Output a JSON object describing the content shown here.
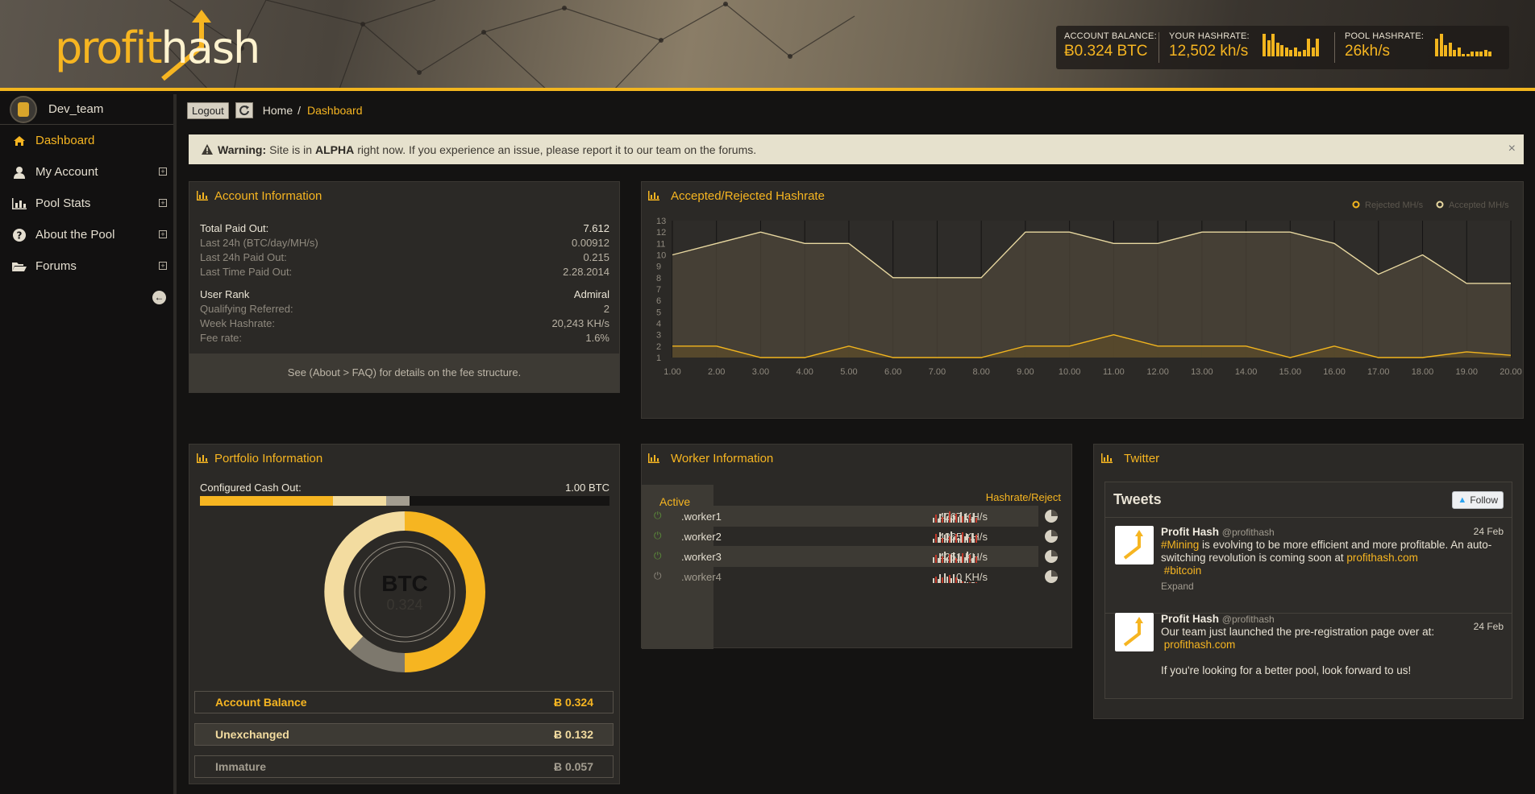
{
  "header": {
    "logo_profit": "profit",
    "logo_hash": "hash",
    "stats": [
      {
        "label": "ACCOUNT BALANCE:",
        "value": "Ƀ0.324 BTC"
      },
      {
        "label": "YOUR HASHRATE:",
        "value": "12,502 kh/s"
      },
      {
        "label": "POOL HASHRATE:",
        "value": "26kh/s"
      }
    ],
    "your_hashrate_spark": [
      10,
      7,
      10,
      6,
      5,
      4,
      3,
      4,
      2,
      3,
      8,
      4,
      8
    ],
    "pool_hashrate_spark": [
      8,
      10,
      5,
      6,
      3,
      4,
      1,
      1,
      2,
      2,
      2,
      3,
      2
    ],
    "accent_color": "#f2b51e"
  },
  "sidebar": {
    "user": "Dev_team",
    "items": [
      {
        "label": "Dashboard",
        "icon": "home-icon",
        "active": true
      },
      {
        "label": "My Account",
        "icon": "user-icon"
      },
      {
        "label": "Pool Stats",
        "icon": "bar-chart-icon"
      },
      {
        "label": "About the Pool",
        "icon": "question-circle-icon"
      },
      {
        "label": "Forums",
        "icon": "folder-open-icon"
      }
    ],
    "expand_symbol": "+",
    "collapse_symbol": "➜"
  },
  "toolbar": {
    "logout": "Logout",
    "breadcrumb_home": "Home",
    "breadcrumb_sep": "/",
    "breadcrumb_current": "Dashboard"
  },
  "warning": {
    "label": "Warning:",
    "text_before": "Site is in",
    "highlight": "ALPHA",
    "text_after": "right now. If you experience an issue, please report it to our team on the forums.",
    "close": "×"
  },
  "account": {
    "title": "Account Information",
    "rows": [
      {
        "k": "Total Paid Out:",
        "v": "7.612",
        "strong": true
      },
      {
        "k": "Last 24h (BTC/day/MH/s)",
        "v": "0.00912"
      },
      {
        "k": "Last 24h Paid Out:",
        "v": "0.215"
      },
      {
        "k": "Last Time Paid Out:",
        "v": "2.28.2014"
      },
      {
        "k": "User Rank",
        "v": "Admiral",
        "strong": true
      },
      {
        "k": "Qualifying Referred:",
        "v": "2"
      },
      {
        "k": "Week Hashrate:",
        "v": "20,243 KH/s"
      },
      {
        "k": "Fee rate:",
        "v": "1.6%"
      }
    ],
    "fee_note": "See (About > FAQ) for details on the fee structure."
  },
  "chart_data": {
    "type": "area",
    "title": "Accepted/Rejected Hashrate",
    "legend_position": "top-right",
    "x": [
      "1.00",
      "2.00",
      "3.00",
      "4.00",
      "5.00",
      "6.00",
      "7.00",
      "8.00",
      "9.00",
      "10.00",
      "11.00",
      "12.00",
      "13.00",
      "14.00",
      "15.00",
      "16.00",
      "17.00",
      "18.00",
      "19.00",
      "20.00"
    ],
    "ylim": [
      1,
      13
    ],
    "yticks": [
      1,
      2,
      3,
      4,
      5,
      6,
      7,
      8,
      9,
      10,
      11,
      12,
      13
    ],
    "grid": true,
    "series": [
      {
        "name": "Rejected MH/s",
        "values": [
          2,
          2,
          1,
          1,
          2,
          1,
          1,
          1,
          2,
          2,
          3,
          2,
          2,
          2,
          1,
          2,
          1,
          1,
          1.5,
          1.2
        ],
        "color": "#f2b51e"
      },
      {
        "name": "Accepted MH/s",
        "values": [
          10,
          11,
          12,
          11,
          11,
          8,
          8,
          8,
          12,
          12,
          11,
          11,
          12,
          12,
          12,
          11,
          8.3,
          10,
          7.5,
          7.5
        ],
        "color": "#e8d8a0"
      }
    ]
  },
  "portfolio": {
    "title": "Portfolio Information",
    "cash_label": "Configured Cash Out:",
    "cash_value": "1.00 BTC",
    "cash_segments": [
      0.325,
      0.13,
      0.057
    ],
    "donut_label": "BTC",
    "donut_value": "0.324",
    "rows": [
      {
        "label": "Account Balance",
        "value": "Ƀ 0.324",
        "color": "#f6b521"
      },
      {
        "label": "Unexchanged",
        "value": "Ƀ 0.132",
        "color": "#f3dca0"
      },
      {
        "label": "Immature",
        "value": "Ƀ 0.057",
        "color": "#a39d90"
      }
    ]
  },
  "workers": {
    "title": "Worker Information",
    "tab": "Active",
    "col_header": "Hashrate/Reject",
    "rows": [
      {
        "name": ".worker1",
        "rate": "4367 KH/s",
        "on": true
      },
      {
        "name": ".worker2",
        "rate": "4365 KH/s",
        "on": true
      },
      {
        "name": ".worker3",
        "rate": "4251 KH/s",
        "on": true
      },
      {
        "name": ".worker4",
        "rate": "0 KH/s",
        "on": false
      }
    ]
  },
  "twitter": {
    "title": "Twitter",
    "box_title": "Tweets",
    "follow": "Follow",
    "tweets": [
      {
        "name": "Profit Hash",
        "handle": "@profithash",
        "date": "24 Feb",
        "tag1": "#Mining",
        "text1": "is evolving to be more efficient and more profitable. An auto-switching revolution is coming soon at",
        "link": "profithash.com",
        "tag2": "#bitcoin",
        "expand": "Expand"
      },
      {
        "name": "Profit Hash",
        "handle": "@profithash",
        "date": "24 Feb",
        "text1": "Our team just launched the pre-registration page over at:",
        "link": "profithash.com",
        "text2": "If you're looking for a better pool, look forward to us!"
      }
    ]
  }
}
